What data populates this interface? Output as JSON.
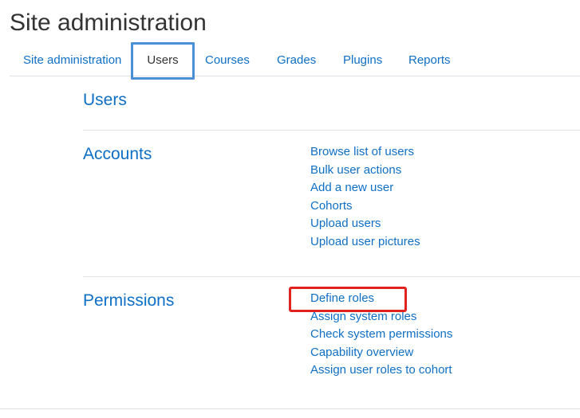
{
  "page": {
    "title": "Site administration"
  },
  "tabs": [
    {
      "label": "Site administration",
      "active": false
    },
    {
      "label": "Users",
      "active": true
    },
    {
      "label": "Courses",
      "active": false
    },
    {
      "label": "Grades",
      "active": false
    },
    {
      "label": "Plugins",
      "active": false
    },
    {
      "label": "Reports",
      "active": false
    }
  ],
  "users_section": {
    "heading": "Users"
  },
  "accounts": {
    "heading": "Accounts",
    "links": [
      "Browse list of users",
      "Bulk user actions",
      "Add a new user",
      "Cohorts",
      "Upload users",
      "Upload user pictures"
    ]
  },
  "permissions": {
    "heading": "Permissions",
    "links": [
      "Define roles",
      "Assign system roles",
      "Check system permissions",
      "Capability overview",
      "Assign user roles to cohort"
    ],
    "highlighted_link": "Define roles"
  },
  "colors": {
    "link": "#0f6fc5",
    "text": "#333333",
    "divider": "#dee2e6",
    "tab_highlight": "#4a90d9",
    "link_highlight": "#e0231e"
  }
}
